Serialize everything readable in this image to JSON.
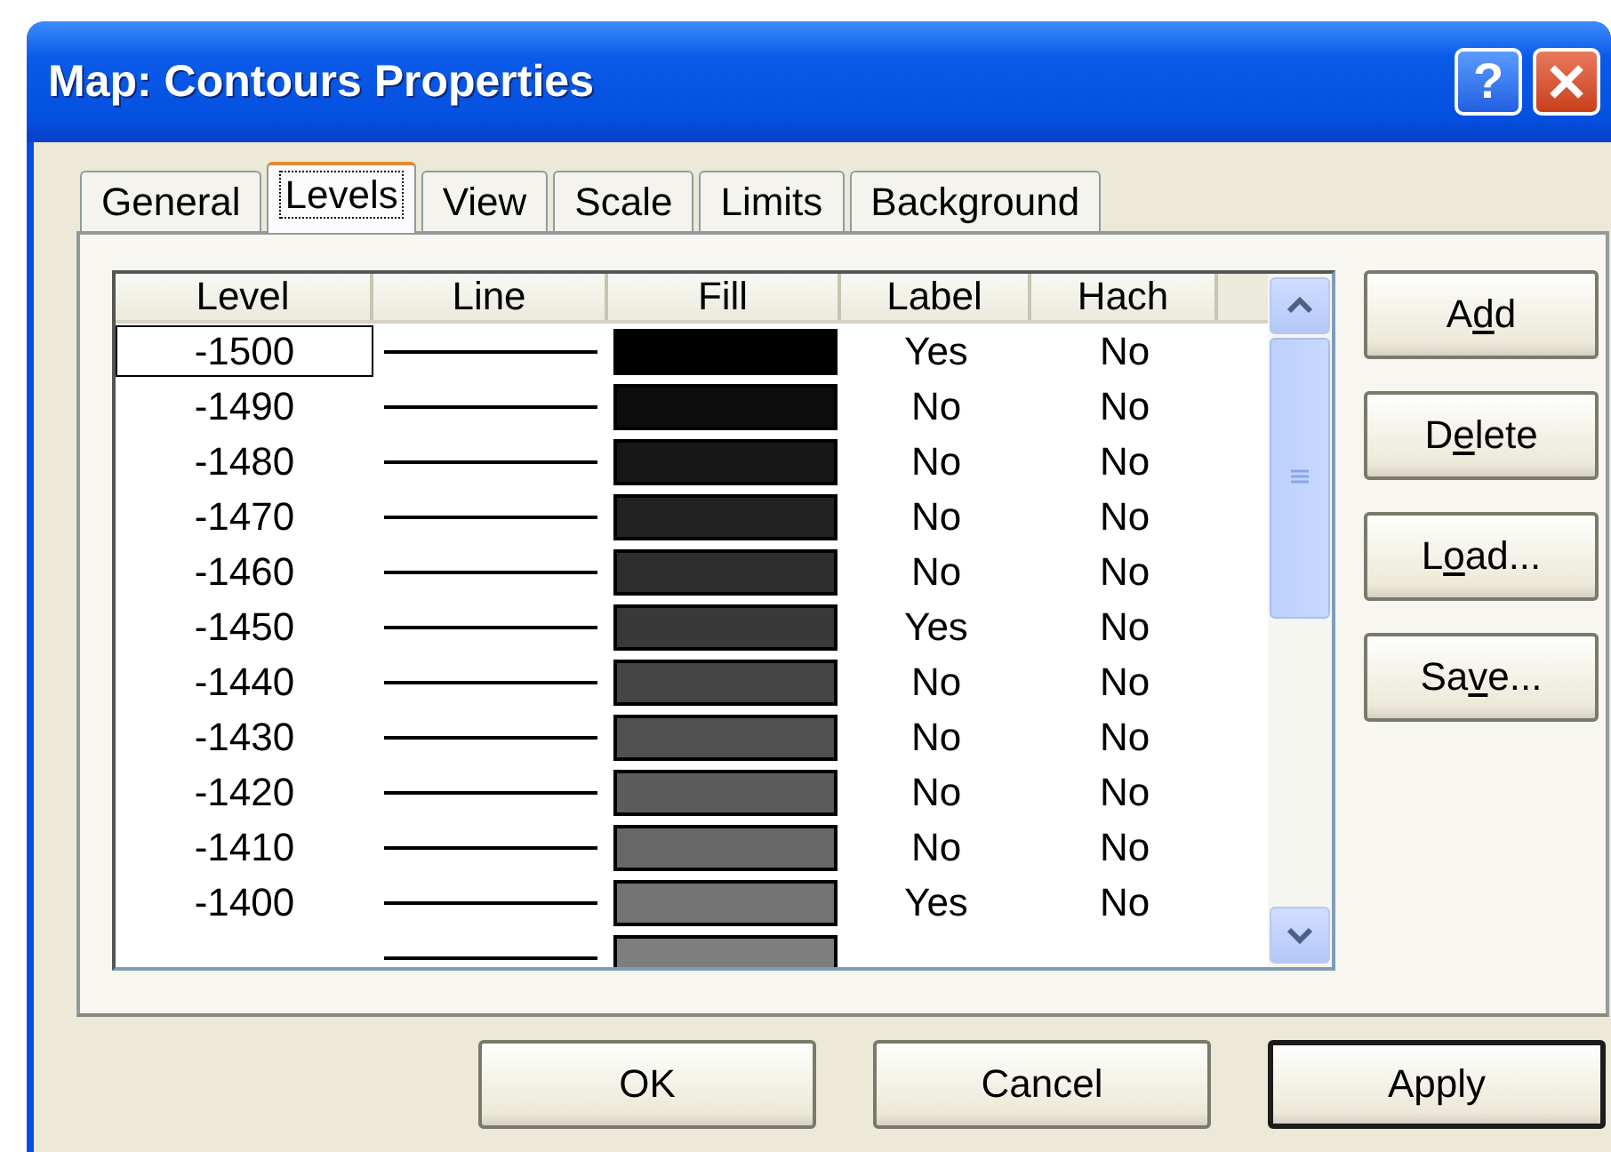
{
  "window": {
    "title": "Map: Contours Properties",
    "title_buttons": [
      {
        "kind": "help",
        "label": "?"
      },
      {
        "kind": "close"
      }
    ]
  },
  "tabs": [
    {
      "label": "General",
      "selected": false
    },
    {
      "label": "Levels",
      "selected": true
    },
    {
      "label": "View",
      "selected": false
    },
    {
      "label": "Scale",
      "selected": false
    },
    {
      "label": "Limits",
      "selected": false
    },
    {
      "label": "Background",
      "selected": false
    }
  ],
  "table": {
    "columns": [
      "Level",
      "Line",
      "Fill",
      "Label",
      "Hach"
    ],
    "rows": [
      {
        "level": "-1500",
        "color": "#000000",
        "label": "Yes",
        "hach": "No",
        "selected": true
      },
      {
        "level": "-1490",
        "color": "#0c0c0c",
        "label": "No",
        "hach": "No",
        "selected": false
      },
      {
        "level": "-1480",
        "color": "#171717",
        "label": "No",
        "hach": "No",
        "selected": false
      },
      {
        "level": "-1470",
        "color": "#222222",
        "label": "No",
        "hach": "No",
        "selected": false
      },
      {
        "level": "-1460",
        "color": "#2e2e2e",
        "label": "No",
        "hach": "No",
        "selected": false
      },
      {
        "level": "-1450",
        "color": "#393939",
        "label": "Yes",
        "hach": "No",
        "selected": false
      },
      {
        "level": "-1440",
        "color": "#454545",
        "label": "No",
        "hach": "No",
        "selected": false
      },
      {
        "level": "-1430",
        "color": "#505050",
        "label": "No",
        "hach": "No",
        "selected": false
      },
      {
        "level": "-1420",
        "color": "#5c5c5c",
        "label": "No",
        "hach": "No",
        "selected": false
      },
      {
        "level": "-1410",
        "color": "#676767",
        "label": "No",
        "hach": "No",
        "selected": false
      },
      {
        "level": "-1400",
        "color": "#737373",
        "label": "Yes",
        "hach": "No",
        "selected": false
      },
      {
        "color": "#7e7e7e",
        "selected": false
      }
    ]
  },
  "side_buttons": [
    {
      "label_parts": [
        "A",
        "d",
        "d"
      ]
    },
    {
      "label_parts": [
        "D",
        "e",
        "lete"
      ]
    },
    {
      "label_parts": [
        "L",
        "o",
        "ad..."
      ]
    },
    {
      "label_parts": [
        "Sa",
        "v",
        "e..."
      ]
    }
  ],
  "buttons": [
    {
      "label": "OK",
      "default": false
    },
    {
      "label": "Cancel",
      "default": false
    },
    {
      "label": "Apply",
      "default": true
    }
  ]
}
